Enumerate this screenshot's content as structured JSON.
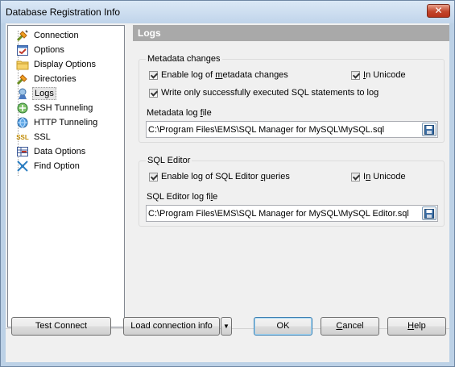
{
  "window": {
    "title": "Database Registration Info",
    "close_glyph": "✕"
  },
  "tree": {
    "items": [
      {
        "label": "Connection",
        "icon": "connection-icon"
      },
      {
        "label": "Options",
        "icon": "options-icon"
      },
      {
        "label": "Display Options",
        "icon": "display-options-icon"
      },
      {
        "label": "Directories",
        "icon": "directories-icon"
      },
      {
        "label": "Logs",
        "icon": "logs-icon",
        "selected": true
      },
      {
        "label": "SSH Tunneling",
        "icon": "ssh-icon"
      },
      {
        "label": "HTTP Tunneling",
        "icon": "http-icon"
      },
      {
        "label": "SSL",
        "icon": "ssl-icon"
      },
      {
        "label": "Data Options",
        "icon": "data-options-icon"
      },
      {
        "label": "Find Option",
        "icon": "find-option-icon"
      }
    ],
    "ssl_icon_text": "SSL"
  },
  "logs": {
    "header": "Logs",
    "metadata": {
      "group_title": "Metadata changes",
      "enable_log_pre": "Enable log of ",
      "enable_log_u": "m",
      "enable_log_post": "etadata changes",
      "unicode_pre": "",
      "unicode_u": "I",
      "unicode_post": "n Unicode",
      "write_only_label": "Write only successfully executed SQL statements to log",
      "file_label_pre": "Metadata log ",
      "file_label_u": "f",
      "file_label_post": "ile",
      "file_value": "C:\\Program Files\\EMS\\SQL Manager for MySQL\\MySQL.sql"
    },
    "sql_editor": {
      "group_title": "SQL Editor",
      "enable_log_pre": "Enable log of SQL Editor ",
      "enable_log_u": "q",
      "enable_log_post": "ueries",
      "unicode_pre": "I",
      "unicode_u": "n",
      "unicode_post": " Unicode",
      "file_label_pre": "SQL Editor log fi",
      "file_label_u": "l",
      "file_label_post": "e",
      "file_value": "C:\\Program Files\\EMS\\SQL Manager for MySQL\\MySQL Editor.sql"
    }
  },
  "buttons": {
    "test_connect": "Test Connect",
    "load_connection_info": "Load connection info",
    "load_arrow": "▼",
    "ok": "OK",
    "cancel_u": "C",
    "cancel_rest": "ancel",
    "help_u": "H",
    "help_rest": "elp"
  }
}
